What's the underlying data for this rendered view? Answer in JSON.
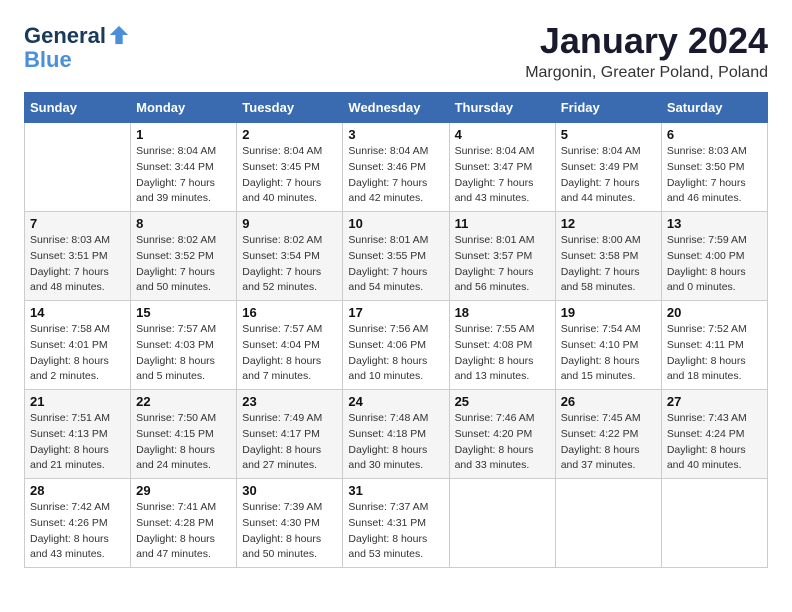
{
  "header": {
    "logo_line1": "General",
    "logo_line2": "Blue",
    "title": "January 2024",
    "location": "Margonin, Greater Poland, Poland"
  },
  "days_of_week": [
    "Sunday",
    "Monday",
    "Tuesday",
    "Wednesday",
    "Thursday",
    "Friday",
    "Saturday"
  ],
  "weeks": [
    [
      {
        "day": "",
        "sunrise": "",
        "sunset": "",
        "daylight": ""
      },
      {
        "day": "1",
        "sunrise": "Sunrise: 8:04 AM",
        "sunset": "Sunset: 3:44 PM",
        "daylight": "Daylight: 7 hours and 39 minutes."
      },
      {
        "day": "2",
        "sunrise": "Sunrise: 8:04 AM",
        "sunset": "Sunset: 3:45 PM",
        "daylight": "Daylight: 7 hours and 40 minutes."
      },
      {
        "day": "3",
        "sunrise": "Sunrise: 8:04 AM",
        "sunset": "Sunset: 3:46 PM",
        "daylight": "Daylight: 7 hours and 42 minutes."
      },
      {
        "day": "4",
        "sunrise": "Sunrise: 8:04 AM",
        "sunset": "Sunset: 3:47 PM",
        "daylight": "Daylight: 7 hours and 43 minutes."
      },
      {
        "day": "5",
        "sunrise": "Sunrise: 8:04 AM",
        "sunset": "Sunset: 3:49 PM",
        "daylight": "Daylight: 7 hours and 44 minutes."
      },
      {
        "day": "6",
        "sunrise": "Sunrise: 8:03 AM",
        "sunset": "Sunset: 3:50 PM",
        "daylight": "Daylight: 7 hours and 46 minutes."
      }
    ],
    [
      {
        "day": "7",
        "sunrise": "Sunrise: 8:03 AM",
        "sunset": "Sunset: 3:51 PM",
        "daylight": "Daylight: 7 hours and 48 minutes."
      },
      {
        "day": "8",
        "sunrise": "Sunrise: 8:02 AM",
        "sunset": "Sunset: 3:52 PM",
        "daylight": "Daylight: 7 hours and 50 minutes."
      },
      {
        "day": "9",
        "sunrise": "Sunrise: 8:02 AM",
        "sunset": "Sunset: 3:54 PM",
        "daylight": "Daylight: 7 hours and 52 minutes."
      },
      {
        "day": "10",
        "sunrise": "Sunrise: 8:01 AM",
        "sunset": "Sunset: 3:55 PM",
        "daylight": "Daylight: 7 hours and 54 minutes."
      },
      {
        "day": "11",
        "sunrise": "Sunrise: 8:01 AM",
        "sunset": "Sunset: 3:57 PM",
        "daylight": "Daylight: 7 hours and 56 minutes."
      },
      {
        "day": "12",
        "sunrise": "Sunrise: 8:00 AM",
        "sunset": "Sunset: 3:58 PM",
        "daylight": "Daylight: 7 hours and 58 minutes."
      },
      {
        "day": "13",
        "sunrise": "Sunrise: 7:59 AM",
        "sunset": "Sunset: 4:00 PM",
        "daylight": "Daylight: 8 hours and 0 minutes."
      }
    ],
    [
      {
        "day": "14",
        "sunrise": "Sunrise: 7:58 AM",
        "sunset": "Sunset: 4:01 PM",
        "daylight": "Daylight: 8 hours and 2 minutes."
      },
      {
        "day": "15",
        "sunrise": "Sunrise: 7:57 AM",
        "sunset": "Sunset: 4:03 PM",
        "daylight": "Daylight: 8 hours and 5 minutes."
      },
      {
        "day": "16",
        "sunrise": "Sunrise: 7:57 AM",
        "sunset": "Sunset: 4:04 PM",
        "daylight": "Daylight: 8 hours and 7 minutes."
      },
      {
        "day": "17",
        "sunrise": "Sunrise: 7:56 AM",
        "sunset": "Sunset: 4:06 PM",
        "daylight": "Daylight: 8 hours and 10 minutes."
      },
      {
        "day": "18",
        "sunrise": "Sunrise: 7:55 AM",
        "sunset": "Sunset: 4:08 PM",
        "daylight": "Daylight: 8 hours and 13 minutes."
      },
      {
        "day": "19",
        "sunrise": "Sunrise: 7:54 AM",
        "sunset": "Sunset: 4:10 PM",
        "daylight": "Daylight: 8 hours and 15 minutes."
      },
      {
        "day": "20",
        "sunrise": "Sunrise: 7:52 AM",
        "sunset": "Sunset: 4:11 PM",
        "daylight": "Daylight: 8 hours and 18 minutes."
      }
    ],
    [
      {
        "day": "21",
        "sunrise": "Sunrise: 7:51 AM",
        "sunset": "Sunset: 4:13 PM",
        "daylight": "Daylight: 8 hours and 21 minutes."
      },
      {
        "day": "22",
        "sunrise": "Sunrise: 7:50 AM",
        "sunset": "Sunset: 4:15 PM",
        "daylight": "Daylight: 8 hours and 24 minutes."
      },
      {
        "day": "23",
        "sunrise": "Sunrise: 7:49 AM",
        "sunset": "Sunset: 4:17 PM",
        "daylight": "Daylight: 8 hours and 27 minutes."
      },
      {
        "day": "24",
        "sunrise": "Sunrise: 7:48 AM",
        "sunset": "Sunset: 4:18 PM",
        "daylight": "Daylight: 8 hours and 30 minutes."
      },
      {
        "day": "25",
        "sunrise": "Sunrise: 7:46 AM",
        "sunset": "Sunset: 4:20 PM",
        "daylight": "Daylight: 8 hours and 33 minutes."
      },
      {
        "day": "26",
        "sunrise": "Sunrise: 7:45 AM",
        "sunset": "Sunset: 4:22 PM",
        "daylight": "Daylight: 8 hours and 37 minutes."
      },
      {
        "day": "27",
        "sunrise": "Sunrise: 7:43 AM",
        "sunset": "Sunset: 4:24 PM",
        "daylight": "Daylight: 8 hours and 40 minutes."
      }
    ],
    [
      {
        "day": "28",
        "sunrise": "Sunrise: 7:42 AM",
        "sunset": "Sunset: 4:26 PM",
        "daylight": "Daylight: 8 hours and 43 minutes."
      },
      {
        "day": "29",
        "sunrise": "Sunrise: 7:41 AM",
        "sunset": "Sunset: 4:28 PM",
        "daylight": "Daylight: 8 hours and 47 minutes."
      },
      {
        "day": "30",
        "sunrise": "Sunrise: 7:39 AM",
        "sunset": "Sunset: 4:30 PM",
        "daylight": "Daylight: 8 hours and 50 minutes."
      },
      {
        "day": "31",
        "sunrise": "Sunrise: 7:37 AM",
        "sunset": "Sunset: 4:31 PM",
        "daylight": "Daylight: 8 hours and 53 minutes."
      },
      {
        "day": "",
        "sunrise": "",
        "sunset": "",
        "daylight": ""
      },
      {
        "day": "",
        "sunrise": "",
        "sunset": "",
        "daylight": ""
      },
      {
        "day": "",
        "sunrise": "",
        "sunset": "",
        "daylight": ""
      }
    ]
  ]
}
